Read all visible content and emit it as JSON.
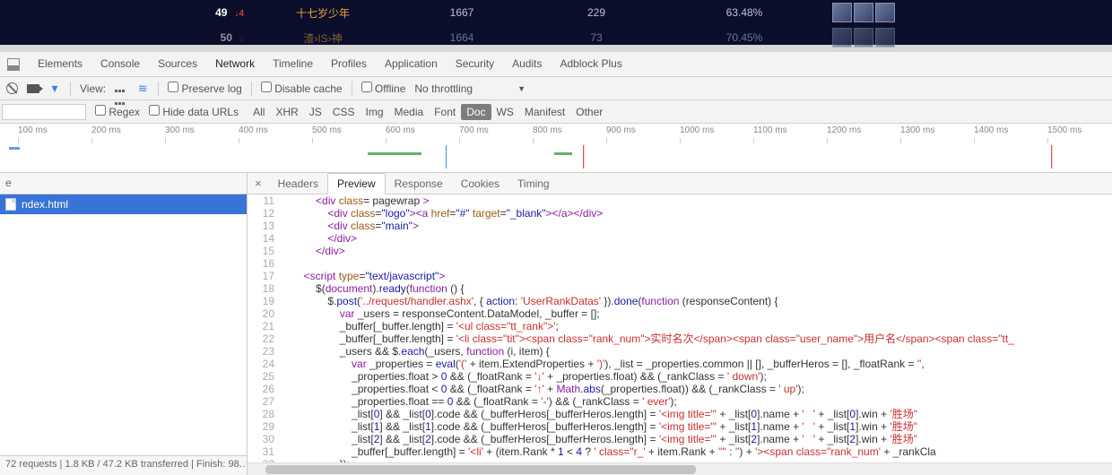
{
  "game_rows": [
    {
      "rank": "49",
      "arrow": "↓4",
      "name": "十七岁少年",
      "c1": "1667",
      "c2": "229",
      "pct": "63.48%"
    },
    {
      "rank": "50",
      "arrow": "↓",
      "name": "渣›IS›神",
      "c1": "1664",
      "c2": "73",
      "pct": "70.45%"
    }
  ],
  "dt_tabs": [
    "Elements",
    "Console",
    "Sources",
    "Network",
    "Timeline",
    "Profiles",
    "Application",
    "Security",
    "Audits",
    "Adblock Plus"
  ],
  "dt_active_tab": "Network",
  "toolbar": {
    "view_label": "View:",
    "preserve": "Preserve log",
    "disable_cache": "Disable cache",
    "offline": "Offline",
    "throttling": "No throttling"
  },
  "filter": {
    "regex": "Regex",
    "hide": "Hide data URLs",
    "types": [
      "All",
      "XHR",
      "JS",
      "CSS",
      "Img",
      "Media",
      "Font",
      "Doc",
      "WS",
      "Manifest",
      "Other"
    ],
    "selected": "Doc"
  },
  "ticks": [
    "100 ms",
    "200 ms",
    "300 ms",
    "400 ms",
    "500 ms",
    "600 ms",
    "700 ms",
    "800 ms",
    "900 ms",
    "1000 ms",
    "1100 ms",
    "1200 ms",
    "1300 ms",
    "1400 ms",
    "1500 ms"
  ],
  "left": {
    "header": "e",
    "item": "ndex.html",
    "status": "72 requests  |  1.8 KB / 47.2 KB transferred  |  Finish: 98…"
  },
  "detail_tabs": [
    "Headers",
    "Preview",
    "Response",
    "Cookies",
    "Timing"
  ],
  "detail_selected": "Preview",
  "gutter_start": 11,
  "code_rows": [
    [
      [
        "pl",
        "            "
      ],
      [
        "tag",
        "<div"
      ],
      [
        "pl",
        " "
      ],
      [
        "attr",
        "class"
      ],
      [
        "pl",
        "="
      ],
      [
        "pl",
        " pagewrap "
      ],
      [
        "tag",
        ">"
      ]
    ],
    [
      [
        "pl",
        "                "
      ],
      [
        "tag",
        "<div"
      ],
      [
        "pl",
        " "
      ],
      [
        "attr",
        "class"
      ],
      [
        "pl",
        "="
      ],
      [
        "str",
        "\"logo\""
      ],
      [
        "tag",
        "><a"
      ],
      [
        "pl",
        " "
      ],
      [
        "attr",
        "href"
      ],
      [
        "pl",
        "="
      ],
      [
        "str",
        "\"#\""
      ],
      [
        "pl",
        " "
      ],
      [
        "attr",
        "target"
      ],
      [
        "pl",
        "="
      ],
      [
        "str",
        "\"_blank\""
      ],
      [
        "tag",
        "></a></div>"
      ]
    ],
    [
      [
        "pl",
        "                "
      ],
      [
        "tag",
        "<div"
      ],
      [
        "pl",
        " "
      ],
      [
        "attr",
        "class"
      ],
      [
        "pl",
        "="
      ],
      [
        "str",
        "\"main\""
      ],
      [
        "tag",
        ">"
      ]
    ],
    [
      [
        "pl",
        "                "
      ],
      [
        "tag",
        "</div>"
      ]
    ],
    [
      [
        "pl",
        "            "
      ],
      [
        "tag",
        "</div>"
      ]
    ],
    [
      [
        "pl",
        ""
      ]
    ],
    [
      [
        "pl",
        "        "
      ],
      [
        "tag",
        "<script"
      ],
      [
        "pl",
        " "
      ],
      [
        "attr",
        "type"
      ],
      [
        "pl",
        "="
      ],
      [
        "str",
        "\"text/javascript\""
      ],
      [
        "tag",
        ">"
      ]
    ],
    [
      [
        "pl",
        "            $"
      ],
      [
        "pl",
        "("
      ],
      [
        "kw",
        "document"
      ],
      [
        "pl",
        ")."
      ],
      [
        "fn",
        "ready"
      ],
      [
        "pl",
        "("
      ],
      [
        "kw",
        "function"
      ],
      [
        "pl",
        " () {"
      ]
    ],
    [
      [
        "pl",
        "                $."
      ],
      [
        "fn",
        "post"
      ],
      [
        "pl",
        "("
      ],
      [
        "s",
        "'../request/handler.ashx'"
      ],
      [
        "pl",
        ", { "
      ],
      [
        "fn",
        "action"
      ],
      [
        "pl",
        ": "
      ],
      [
        "s",
        "'UserRankDatas'"
      ],
      [
        "pl",
        " })."
      ],
      [
        "fn",
        "done"
      ],
      [
        "pl",
        "("
      ],
      [
        "kw",
        "function"
      ],
      [
        "pl",
        " (responseContent) {"
      ]
    ],
    [
      [
        "pl",
        "                    "
      ],
      [
        "kw",
        "var"
      ],
      [
        "pl",
        " _users = responseContent.DataModel, _buffer = [];"
      ]
    ],
    [
      [
        "pl",
        "                    _buffer[_buffer.length] = "
      ],
      [
        "s",
        "'<ul class=\"tt_rank\">'"
      ],
      [
        "pl",
        ";"
      ]
    ],
    [
      [
        "pl",
        "                    _buffer[_buffer.length] = "
      ],
      [
        "s",
        "'<li class=\"tit\"><span class=\"rank_num\">"
      ],
      [
        "cn",
        "实时名次"
      ],
      [
        "s",
        "</span><span class=\"user_name\">"
      ],
      [
        "cn",
        "用户名"
      ],
      [
        "s",
        "</span><span class=\"tt_"
      ]
    ],
    [
      [
        "pl",
        "                    _users && $."
      ],
      [
        "fn",
        "each"
      ],
      [
        "pl",
        "(_users, "
      ],
      [
        "kw",
        "function"
      ],
      [
        "pl",
        " (i, item) {"
      ]
    ],
    [
      [
        "pl",
        "                        "
      ],
      [
        "kw",
        "var"
      ],
      [
        "pl",
        " _properties = "
      ],
      [
        "fn",
        "eval"
      ],
      [
        "pl",
        "("
      ],
      [
        "s",
        "'('"
      ],
      [
        "pl",
        " + item.ExtendProperties + "
      ],
      [
        "s",
        "')'"
      ],
      [
        "pl",
        "), _list = _properties.common || [], _bufferHeros = [], _floatRank = "
      ],
      [
        "s",
        "''"
      ],
      [
        "pl",
        ","
      ]
    ],
    [
      [
        "pl",
        "                        _properties.float > "
      ],
      [
        "num",
        "0"
      ],
      [
        "pl",
        " && (_floatRank = "
      ],
      [
        "s",
        "'↓'"
      ],
      [
        "pl",
        " + _properties.float) && (_rankClass = "
      ],
      [
        "s",
        "' down'"
      ],
      [
        "pl",
        ");"
      ]
    ],
    [
      [
        "pl",
        "                        _properties.float < "
      ],
      [
        "num",
        "0"
      ],
      [
        "pl",
        " && (_floatRank = "
      ],
      [
        "s",
        "'↑'"
      ],
      [
        "pl",
        " + "
      ],
      [
        "kw",
        "Math"
      ],
      [
        "pl",
        "."
      ],
      [
        "fn",
        "abs"
      ],
      [
        "pl",
        "(_properties.float)) && (_rankClass = "
      ],
      [
        "s",
        "' up'"
      ],
      [
        "pl",
        ");"
      ]
    ],
    [
      [
        "pl",
        "                        _properties.float == "
      ],
      [
        "num",
        "0"
      ],
      [
        "pl",
        " && (_floatRank = "
      ],
      [
        "s",
        "'-'"
      ],
      [
        "pl",
        ") && (_rankClass = "
      ],
      [
        "s",
        "' ever'"
      ],
      [
        "pl",
        ");"
      ]
    ],
    [
      [
        "pl",
        "                        _list["
      ],
      [
        "num",
        "0"
      ],
      [
        "pl",
        "] && _list["
      ],
      [
        "num",
        "0"
      ],
      [
        "pl",
        "].code && (_bufferHeros[_bufferHeros.length] = "
      ],
      [
        "s",
        "'<img title=\"'"
      ],
      [
        "pl",
        " + _list["
      ],
      [
        "num",
        "0"
      ],
      [
        "pl",
        "].name + "
      ],
      [
        "s",
        "'   '"
      ],
      [
        "pl",
        " + _list["
      ],
      [
        "num",
        "0"
      ],
      [
        "pl",
        "].win + "
      ],
      [
        "s",
        "'"
      ],
      [
        "cn",
        "胜场"
      ],
      [
        "s",
        "\""
      ]
    ],
    [
      [
        "pl",
        "                        _list["
      ],
      [
        "num",
        "1"
      ],
      [
        "pl",
        "] && _list["
      ],
      [
        "num",
        "1"
      ],
      [
        "pl",
        "].code && (_bufferHeros[_bufferHeros.length] = "
      ],
      [
        "s",
        "'<img title=\"'"
      ],
      [
        "pl",
        " + _list["
      ],
      [
        "num",
        "1"
      ],
      [
        "pl",
        "].name + "
      ],
      [
        "s",
        "'   '"
      ],
      [
        "pl",
        " + _list["
      ],
      [
        "num",
        "1"
      ],
      [
        "pl",
        "].win + "
      ],
      [
        "s",
        "'"
      ],
      [
        "cn",
        "胜场"
      ],
      [
        "s",
        "\""
      ]
    ],
    [
      [
        "pl",
        "                        _list["
      ],
      [
        "num",
        "2"
      ],
      [
        "pl",
        "] && _list["
      ],
      [
        "num",
        "2"
      ],
      [
        "pl",
        "].code && (_bufferHeros[_bufferHeros.length] = "
      ],
      [
        "s",
        "'<img title=\"'"
      ],
      [
        "pl",
        " + _list["
      ],
      [
        "num",
        "2"
      ],
      [
        "pl",
        "].name + "
      ],
      [
        "s",
        "'   '"
      ],
      [
        "pl",
        " + _list["
      ],
      [
        "num",
        "2"
      ],
      [
        "pl",
        "].win + "
      ],
      [
        "s",
        "'"
      ],
      [
        "cn",
        "胜场"
      ],
      [
        "s",
        "\""
      ]
    ],
    [
      [
        "pl",
        "                        _buffer[_buffer.length] = "
      ],
      [
        "s",
        "'<li'"
      ],
      [
        "pl",
        " + (item.Rank * "
      ],
      [
        "num",
        "1"
      ],
      [
        "pl",
        " < "
      ],
      [
        "num",
        "4"
      ],
      [
        "pl",
        " ? "
      ],
      [
        "s",
        "' class=\"r_'"
      ],
      [
        "pl",
        " + item.Rank + "
      ],
      [
        "s",
        "'\"'"
      ],
      [
        "pl",
        " : "
      ],
      [
        "s",
        "''"
      ],
      [
        "pl",
        ") + "
      ],
      [
        "s",
        "'><span class=\"rank_num'"
      ],
      [
        "pl",
        " + _rankCla"
      ]
    ],
    [
      [
        "pl",
        "                    });"
      ]
    ]
  ]
}
